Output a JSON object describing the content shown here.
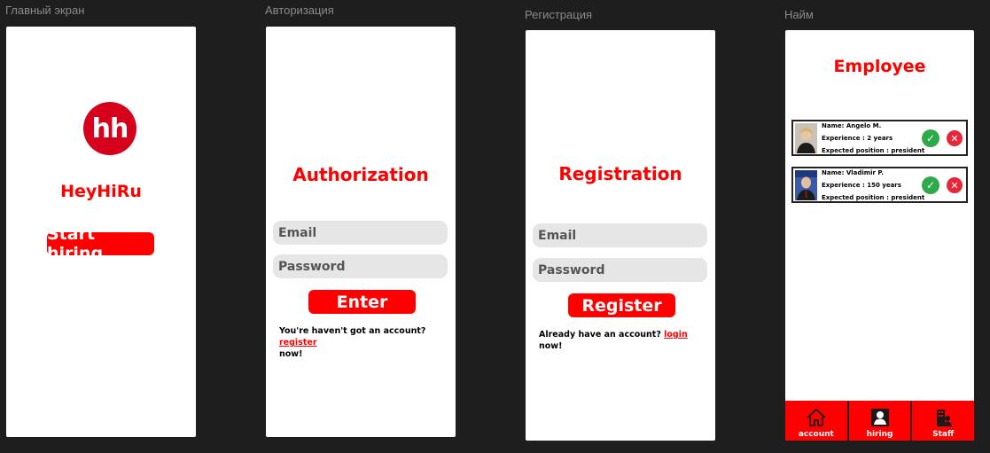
{
  "frames": {
    "home_title": "Главный экран",
    "auth_title": "Авторизация",
    "reg_title": "Регистрация",
    "hire_title": "Найм"
  },
  "home": {
    "logo_text": "hh",
    "app_name": "HeyHiRu",
    "start_button": "Start hiring"
  },
  "auth": {
    "title": "Authorization",
    "email_placeholder": "Email",
    "password_placeholder": "Password",
    "enter_button": "Enter",
    "footer_prefix": "You're haven't got an account?",
    "footer_link": "register",
    "footer_suffix": "now!"
  },
  "register": {
    "title": "Registration",
    "email_placeholder": "Email",
    "password_placeholder": "Password",
    "register_button": "Register",
    "footer_prefix": "Already have an account?",
    "footer_link": "login",
    "footer_suffix": "now!"
  },
  "hire": {
    "title": "Employee",
    "employees": [
      {
        "name": "Name: Angelo M.",
        "experience": "Experience : 2 years",
        "position": "Expected position : president"
      },
      {
        "name": "Name: Vladimir P.",
        "experience": "Experience : 150 years",
        "position": "Expected position : president"
      }
    ],
    "nav": {
      "account": "account",
      "hiring": "hiring",
      "staff": "Staff"
    }
  },
  "colors": {
    "accent": "#ff0000",
    "accept": "#2eaa4a",
    "reject": "#e8263a",
    "background": "#1e1e1e"
  }
}
